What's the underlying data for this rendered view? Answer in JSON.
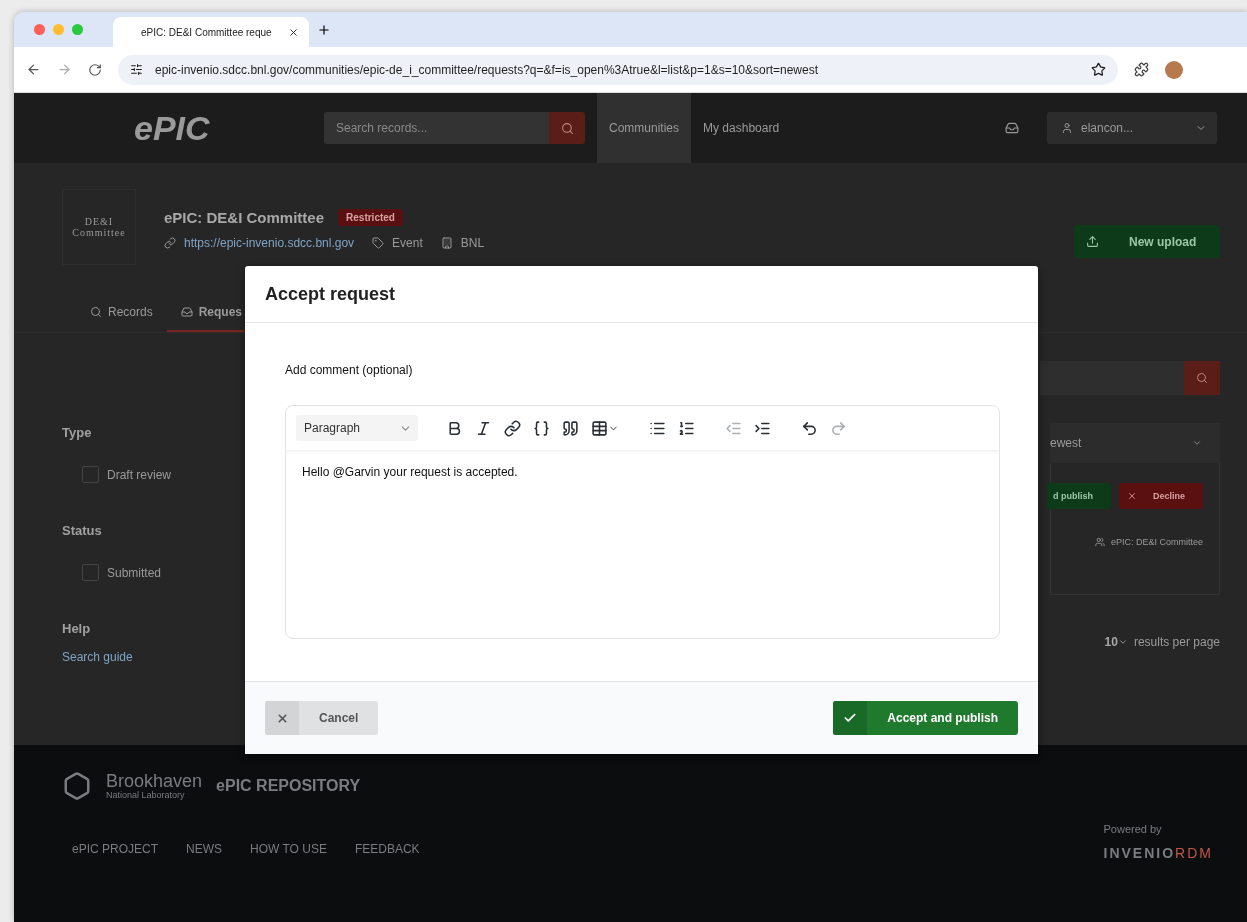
{
  "browser": {
    "tab_title": "ePIC: DE&I Committee reque",
    "url": "epic-invenio.sdcc.bnl.gov/communities/epic-de_i_committee/requests?q=&f=is_open%3Atrue&l=list&p=1&s=10&sort=newest"
  },
  "header": {
    "logo": "ePIC",
    "search_placeholder": "Search records...",
    "nav": [
      {
        "label": "Communities",
        "selected": true
      },
      {
        "label": "My dashboard",
        "selected": false
      }
    ],
    "user": "elancon..."
  },
  "community": {
    "logo_lines": [
      "DE&I",
      "Committee"
    ],
    "title": "ePIC: DE&I Committee",
    "badge": "Restricted",
    "link": "https://epic-invenio.sdcc.bnl.gov",
    "tags": [
      {
        "kind": "type",
        "label": "Event"
      },
      {
        "kind": "org",
        "label": "BNL"
      }
    ],
    "new_upload": "New upload"
  },
  "tabs": [
    {
      "label": "Records",
      "selected": false
    },
    {
      "label": "Reques",
      "selected": true
    }
  ],
  "filters": [
    {
      "title": "Type",
      "options": [
        {
          "label": "Draft review",
          "checked": false
        }
      ]
    },
    {
      "title": "Status",
      "options": [
        {
          "label": "Submitted",
          "checked": false
        }
      ]
    }
  ],
  "help": {
    "title": "Help",
    "link": "Search guide"
  },
  "results": {
    "sort": "ewest",
    "actions": [
      {
        "kind": "accept",
        "label": "d publish"
      },
      {
        "kind": "decline",
        "label": "Decline"
      }
    ],
    "community": "ePIC: DE&I Committee",
    "per_page": "10",
    "per_page_label": "results per page"
  },
  "modal": {
    "title": "Accept request",
    "comment_label": "Add comment (optional)",
    "block_style": "Paragraph",
    "tools": [
      {
        "kind": "bold",
        "disabled": false
      },
      {
        "kind": "italic",
        "disabled": false
      },
      {
        "kind": "link",
        "disabled": false
      },
      {
        "kind": "code",
        "disabled": false
      },
      {
        "kind": "quote",
        "disabled": false
      },
      {
        "kind": "table",
        "disabled": false
      },
      {
        "kind": "bullets",
        "disabled": false
      },
      {
        "kind": "numbers",
        "disabled": false
      },
      {
        "kind": "outdent",
        "disabled": true
      },
      {
        "kind": "indent",
        "disabled": false
      },
      {
        "kind": "undo",
        "disabled": false
      },
      {
        "kind": "redo",
        "disabled": true
      }
    ],
    "text": "Hello @Garvin your request is accepted.",
    "cancel": "Cancel",
    "accept": "Accept and publish"
  },
  "footer": {
    "org": "Brookhaven",
    "org_sub": "National Laboratory",
    "repo": "ePIC REPOSITORY",
    "links": [
      "ePIC PROJECT",
      "NEWS",
      "HOW TO USE",
      "FEEDBACK"
    ],
    "powered_by": "Powered by",
    "engine": "INVENIO",
    "engine_suffix": "RDM"
  }
}
